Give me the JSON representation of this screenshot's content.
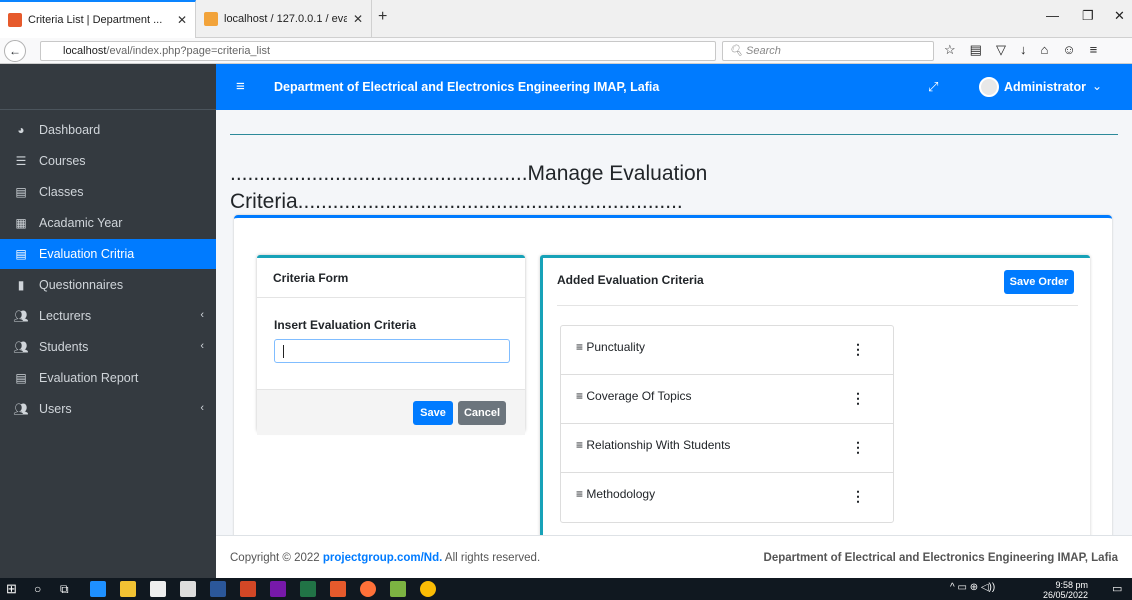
{
  "browser": {
    "tabs": [
      {
        "title": "Criteria List | Department ..."
      },
      {
        "title": "localhost / 127.0.0.1 / eval..."
      }
    ],
    "url_host": "localhost",
    "url_path": "/eval/index.php?page=criteria_list",
    "search_placeholder": "Search"
  },
  "sidebar": {
    "items": [
      {
        "label": "Dashboard",
        "icon": "dashboard-icon"
      },
      {
        "label": "Courses",
        "icon": "list-icon"
      },
      {
        "label": "Classes",
        "icon": "list-icon"
      },
      {
        "label": "Acadamic Year",
        "icon": "calendar-icon"
      },
      {
        "label": "Evaluation Critria",
        "icon": "list-icon",
        "active": true
      },
      {
        "label": "Questionnaires",
        "icon": "file-icon"
      },
      {
        "label": "Lecturers",
        "icon": "users-icon"
      },
      {
        "label": "Students",
        "icon": "users-icon"
      },
      {
        "label": "Evaluation Report",
        "icon": "list-icon"
      },
      {
        "label": "Users",
        "icon": "users-icon"
      }
    ]
  },
  "topnav": {
    "title": "Department of Electrical and Electronics Engineering IMAP, Lafia",
    "user": "Administrator"
  },
  "page": {
    "title_line1": "...................................................Manage Evaluation",
    "title_line2": "Criteria.................................................................."
  },
  "form": {
    "header": "Criteria Form",
    "label": "Insert Evaluation Criteria",
    "value": "",
    "save": "Save",
    "cancel": "Cancel"
  },
  "criteria": {
    "header": "Added Evaluation Criteria",
    "save_order": "Save Order",
    "items": [
      "Punctuality",
      "Coverage Of Topics",
      "Relationship With Students",
      "Methodology"
    ]
  },
  "footer": {
    "copyright_prefix": "Copyright © 2022 ",
    "link": "projectgroup.com/Nd.",
    "suffix": " All rights reserved.",
    "dept": "Department of Electrical and Electronics Engineering IMAP, Lafia"
  },
  "taskbar": {
    "time": "9:58 pm",
    "date": "26/05/2022"
  },
  "colors": {
    "primary": "#007bff",
    "sidebar": "#343a40",
    "accent": "#17a2b8"
  }
}
